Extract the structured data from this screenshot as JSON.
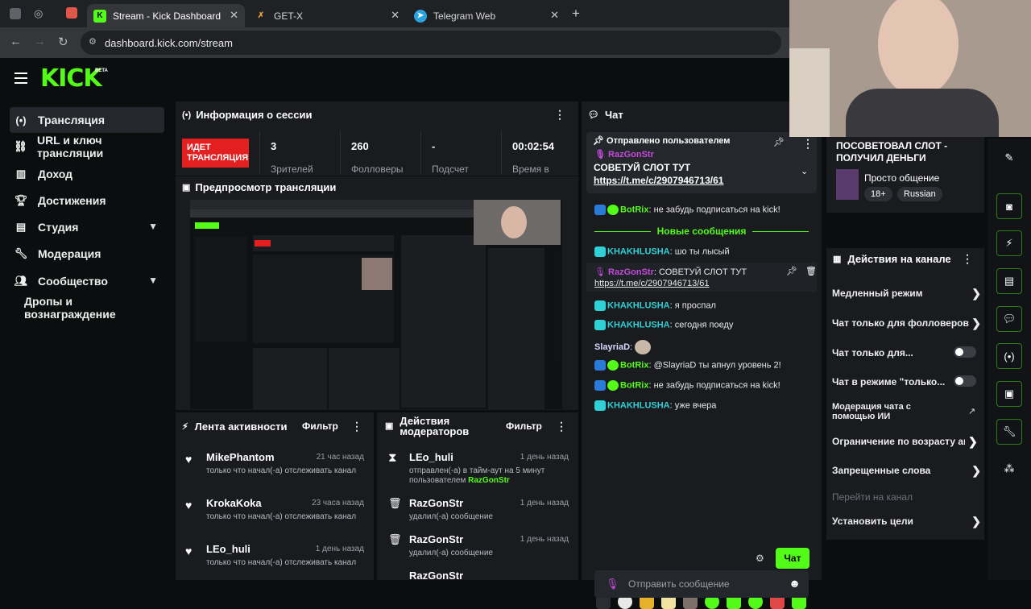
{
  "browser": {
    "tabs": [
      {
        "title": "Stream - Kick Dashboard",
        "active": true
      },
      {
        "title": "GET-X",
        "active": false
      },
      {
        "title": "Telegram Web",
        "active": false
      }
    ],
    "new_tab": "+",
    "url": "dashboard.kick.com/stream"
  },
  "brand": {
    "logo": "KICK",
    "beta": "BETA",
    "accent": "#53fc18"
  },
  "sidebar": {
    "items": [
      {
        "label": "Трансляция",
        "icon": "broadcast-icon"
      },
      {
        "label": "URL и ключ трансляции",
        "icon": "link-icon"
      },
      {
        "label": "Доход",
        "icon": "chart-icon"
      },
      {
        "label": "Достижения",
        "icon": "trophy-icon"
      },
      {
        "label": "Студия",
        "icon": "studio-icon"
      },
      {
        "label": "Модерация",
        "icon": "wrench-icon"
      },
      {
        "label": "Сообщество",
        "icon": "community-icon"
      },
      {
        "label": "Дропы и вознаграждение",
        "icon": ""
      }
    ]
  },
  "session": {
    "title": "Информация о сессии",
    "live_line1": "ИДЕТ",
    "live_line2": "ТРАНСЛЯЦИЯ",
    "stats": [
      {
        "value": "3",
        "label": "Зрителей"
      },
      {
        "value": "260",
        "label": "Фолловеры"
      },
      {
        "value": "-",
        "label": "Подсчет"
      },
      {
        "value": "00:02:54",
        "label": "Время в"
      }
    ]
  },
  "preview": {
    "title": "Предпросмотр трансляции"
  },
  "activity": {
    "title": "Лента активности",
    "filter": "Фильтр",
    "items": [
      {
        "name": "MikePhantom",
        "time": "21 час назад",
        "desc": "только что начал(-а) отслеживать канал"
      },
      {
        "name": "KrokaKoka",
        "time": "23 часа назад",
        "desc": "только что начал(-а) отслеживать канал"
      },
      {
        "name": "LEo_huli",
        "time": "1 день назад",
        "desc": "только что начал(-а) отслеживать канал"
      }
    ]
  },
  "modactions": {
    "title_line1": "Действия",
    "title_line2": "модераторов",
    "filter": "Фильтр",
    "items": [
      {
        "name": "LEo_huli",
        "time": "1 день назад",
        "desc": "отправлен(-а) в тайм-аут на 5 минут пользователем",
        "by": "RazGonStr"
      },
      {
        "name": "RazGonStr",
        "time": "1 день назад",
        "desc": "удалил(-а) сообщение",
        "by": ""
      },
      {
        "name": "RazGonStr",
        "time": "1 день назад",
        "desc": "удалил(-а) сообщение",
        "by": ""
      },
      {
        "name": "RazGonStr",
        "time": "",
        "desc": "",
        "by": ""
      }
    ]
  },
  "chat": {
    "title": "Чат",
    "pinned_by": "Отправлено пользователем",
    "pinned_user": "RazGonStr",
    "pinned_text": "СОВЕТУЙ СЛОТ ТУТ",
    "pinned_link": "https://t.me/c/2907946713/61",
    "new_messages": "Новые сообщения",
    "messages": [
      {
        "user": "BotRix",
        "text": ": не забудь подписаться на kick!",
        "color": "#53fc18"
      },
      {
        "user": "KHAKHLUSHA",
        "text": ": шо ты лысый",
        "color": "#2fd0d6"
      },
      {
        "user": "RazGonStr",
        "text": ": СОВЕТУЙ СЛОТ ТУТ",
        "color": "#c54ad8"
      },
      {
        "user": "",
        "text": "https://t.me/c/2907946713/61",
        "color": "#ffffff"
      },
      {
        "user": "KHAKHLUSHA",
        "text": ": я проспал",
        "color": "#2fd0d6"
      },
      {
        "user": "KHAKHLUSHA",
        "text": ": сегодня поеду",
        "color": "#2fd0d6"
      },
      {
        "user": "SlayriaD",
        "text": ":",
        "color": "#d9d9ff"
      },
      {
        "user": "BotRix",
        "text": ": @SlayriaD ты апнул уровень 2!",
        "color": "#53fc18"
      },
      {
        "user": "BotRix",
        "text": ": не забудь подписаться на kick!",
        "color": "#53fc18"
      },
      {
        "user": "KHAKHLUSHA",
        "text": ": уже вчера",
        "color": "#2fd0d6"
      }
    ],
    "input_placeholder": "Отправить сообщение",
    "send_label": "Чат"
  },
  "stream_info": {
    "title_line1": "ПОСОВЕТОВАЛ СЛОТ -",
    "title_line2": "ПОЛУЧИЛ ДЕНЬГИ",
    "category": "Просто общение",
    "tags": [
      "18+",
      "Russian"
    ]
  },
  "channel_actions": {
    "title": "Действия на канале",
    "items": [
      {
        "label": "Медленный режим",
        "control": "arrow"
      },
      {
        "label": "Чат только для фолловеров",
        "control": "arrow"
      },
      {
        "label": "Чат только для...",
        "control": "toggle"
      },
      {
        "label": "Чат в режиме \"только...",
        "control": "toggle"
      },
      {
        "label": "Модерация чата с помощью ИИ",
        "control": "external"
      },
      {
        "label": "Ограничение по возрасту ан",
        "control": "arrow"
      },
      {
        "label": "Запрещенные слова",
        "control": "arrow"
      },
      {
        "label": "Перейти на канал",
        "control": "none"
      },
      {
        "label": "Установить цели",
        "control": "arrow"
      }
    ]
  }
}
